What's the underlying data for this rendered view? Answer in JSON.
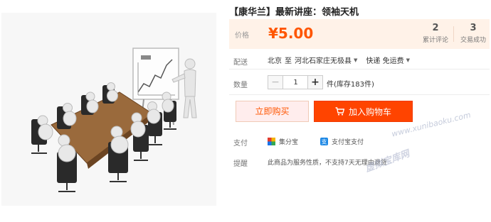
{
  "product": {
    "title": "【康华兰】最新讲座：领袖天机",
    "image_alt": "会议室演讲人物插图"
  },
  "price": {
    "label": "价格",
    "value": "¥5.00"
  },
  "stats": {
    "reviews_count": "2",
    "reviews_label": "累计评论",
    "trades_count": "3",
    "trades_label": "交易成功"
  },
  "shipping": {
    "label": "配送",
    "from": "北京",
    "to_word": "至",
    "destination": "河北石家庄无极县",
    "method": "快递 免运费"
  },
  "quantity": {
    "label": "数量",
    "value": "1",
    "minus": "−",
    "plus": "+",
    "stock_text": "件(库存183件)"
  },
  "buttons": {
    "buy_now": "立即购买",
    "add_to_cart": "加入购物车"
  },
  "payment": {
    "label": "支付",
    "methods": [
      "集分宝",
      "支付宝支付"
    ]
  },
  "notice": {
    "label": "提醒",
    "text": "此商品为服务性质，不支持7天无理由退货"
  },
  "watermark": {
    "url": "www.xunibaoku.com",
    "name": "虚拟宝库网"
  },
  "colors": {
    "accent": "#ff5500",
    "cart_button": "#ff4400",
    "price_bg": "#fff2e8"
  }
}
